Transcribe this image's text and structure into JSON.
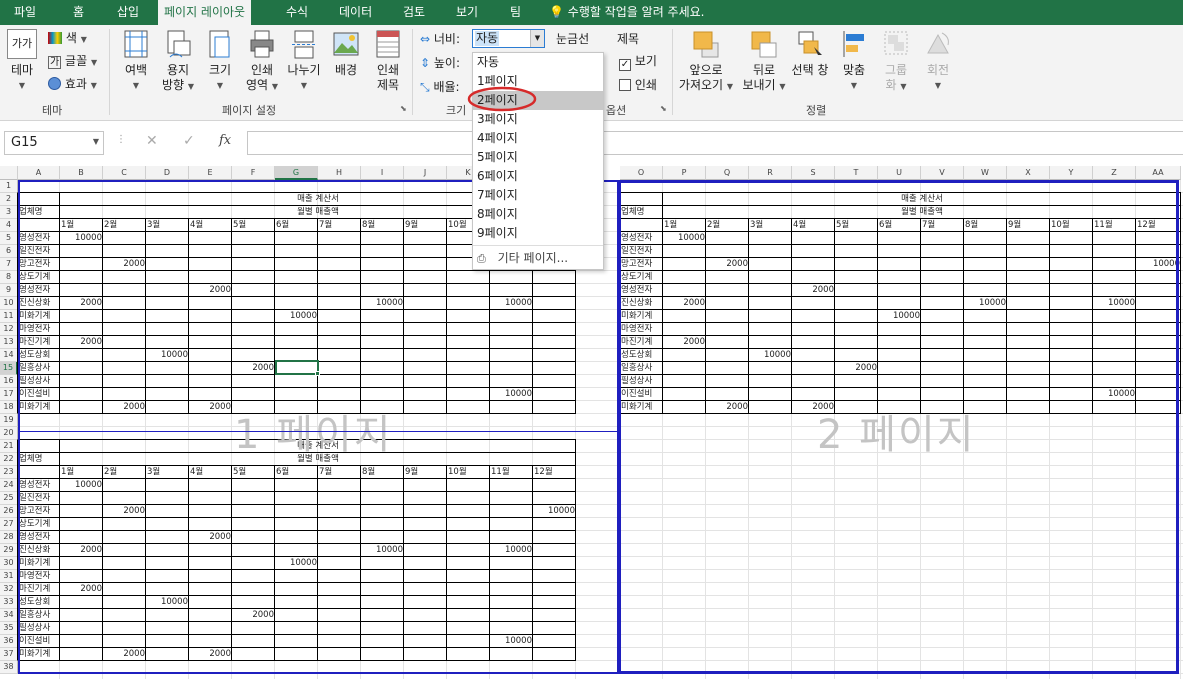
{
  "tabs": [
    "파일",
    "홈",
    "삽입",
    "페이지 레이아웃",
    "수식",
    "데이터",
    "검토",
    "보기",
    "팀"
  ],
  "tell_me": "수행할 작업을 알려 주세요.",
  "ribbon": {
    "theme": {
      "themes": "테마",
      "colors": "색",
      "fonts": "글꼴",
      "effects": "효과",
      "group": "테마",
      "icon_text": "가가"
    },
    "page_setup": {
      "margins": "여백",
      "orientation": [
        "용지",
        "방향"
      ],
      "size": "크기",
      "print_area": [
        "인쇄",
        "영역"
      ],
      "breaks": "나누기",
      "background": "배경",
      "print_titles": [
        "인쇄",
        "제목"
      ],
      "group": "페이지 설정"
    },
    "scale": {
      "width_label": "너비:",
      "width_value": "자동",
      "height_label": "높이:",
      "scale_label": "배율:",
      "group": "크기"
    },
    "sheet_options": {
      "gridlines": "눈금선",
      "headings": "제목",
      "view": "보기",
      "print": "인쇄",
      "group": "옵션"
    },
    "arrange": {
      "bring_forward": [
        "앞으로",
        "가져오기"
      ],
      "send_backward": [
        "뒤로",
        "보내기"
      ],
      "selection_pane": "선택 창",
      "align": "맞춤",
      "group_btn": [
        "그룹",
        "화"
      ],
      "rotate": "회전",
      "group": "정렬"
    }
  },
  "width_dropdown": {
    "items": [
      "자동",
      "1페이지",
      "2페이지",
      "3페이지",
      "4페이지",
      "5페이지",
      "6페이지",
      "7페이지",
      "8페이지",
      "9페이지"
    ],
    "selected": "2페이지",
    "more": "기타 페이지..."
  },
  "formula_bar": {
    "name_box": "G15",
    "fx": "fx"
  },
  "columns": [
    "A",
    "B",
    "C",
    "D",
    "E",
    "F",
    "G",
    "H",
    "I",
    "J",
    "K",
    "L",
    "M",
    "N",
    "O",
    "P",
    "Q",
    "R",
    "S",
    "T",
    "U",
    "V",
    "W",
    "X",
    "Y",
    "Z",
    "AA"
  ],
  "selected_column": "G",
  "selected_row": 15,
  "row_count": 38,
  "sheet": {
    "title": "매출 계산서",
    "subtitle": "월별 매출액",
    "company_header": "업체명",
    "months": [
      "1월",
      "2월",
      "3월",
      "4월",
      "5월",
      "6월",
      "7월",
      "8월",
      "9월",
      "10월",
      "11월",
      "12월"
    ],
    "companies": [
      "영성전자",
      "일진전자",
      "망고전자",
      "상도기계",
      "영성전자",
      "진신상화",
      "미화기계",
      "마영전자",
      "마진기계",
      "성도상회",
      "일흥상사",
      "필성상사",
      "이진설비",
      "미화기계"
    ],
    "values_block1": [
      [
        10000,
        null,
        null,
        null,
        null,
        null,
        null,
        null,
        null,
        null,
        null,
        null
      ],
      [
        null,
        null,
        null,
        null,
        null,
        null,
        null,
        null,
        null,
        null,
        null,
        null
      ],
      [
        null,
        2000,
        null,
        null,
        null,
        null,
        null,
        null,
        null,
        null,
        null,
        10000
      ],
      [
        null,
        null,
        null,
        null,
        null,
        null,
        null,
        null,
        null,
        null,
        null,
        null
      ],
      [
        null,
        null,
        null,
        2000,
        null,
        null,
        null,
        null,
        null,
        null,
        null,
        null
      ],
      [
        2000,
        null,
        null,
        null,
        null,
        null,
        null,
        10000,
        null,
        null,
        10000,
        null
      ],
      [
        null,
        null,
        null,
        null,
        null,
        10000,
        null,
        null,
        null,
        null,
        null,
        null
      ],
      [
        null,
        null,
        null,
        null,
        null,
        null,
        null,
        null,
        null,
        null,
        null,
        null
      ],
      [
        2000,
        null,
        null,
        null,
        null,
        null,
        null,
        null,
        null,
        null,
        null,
        null
      ],
      [
        null,
        null,
        10000,
        null,
        null,
        null,
        null,
        null,
        null,
        null,
        null,
        null
      ],
      [
        null,
        null,
        null,
        null,
        2000,
        null,
        null,
        null,
        null,
        null,
        null,
        null
      ],
      [
        null,
        null,
        null,
        null,
        null,
        null,
        null,
        null,
        null,
        null,
        null,
        null
      ],
      [
        null,
        null,
        null,
        null,
        null,
        null,
        null,
        null,
        null,
        null,
        10000,
        null
      ],
      [
        null,
        2000,
        null,
        2000,
        null,
        null,
        null,
        null,
        null,
        null,
        null,
        null
      ]
    ]
  },
  "watermarks": {
    "page1": "1 페이지",
    "page2": "2 페이지"
  },
  "colors": {
    "excel_green": "#217346",
    "page_border": "#1f1fbf",
    "annotation_red": "#d62a2a"
  }
}
